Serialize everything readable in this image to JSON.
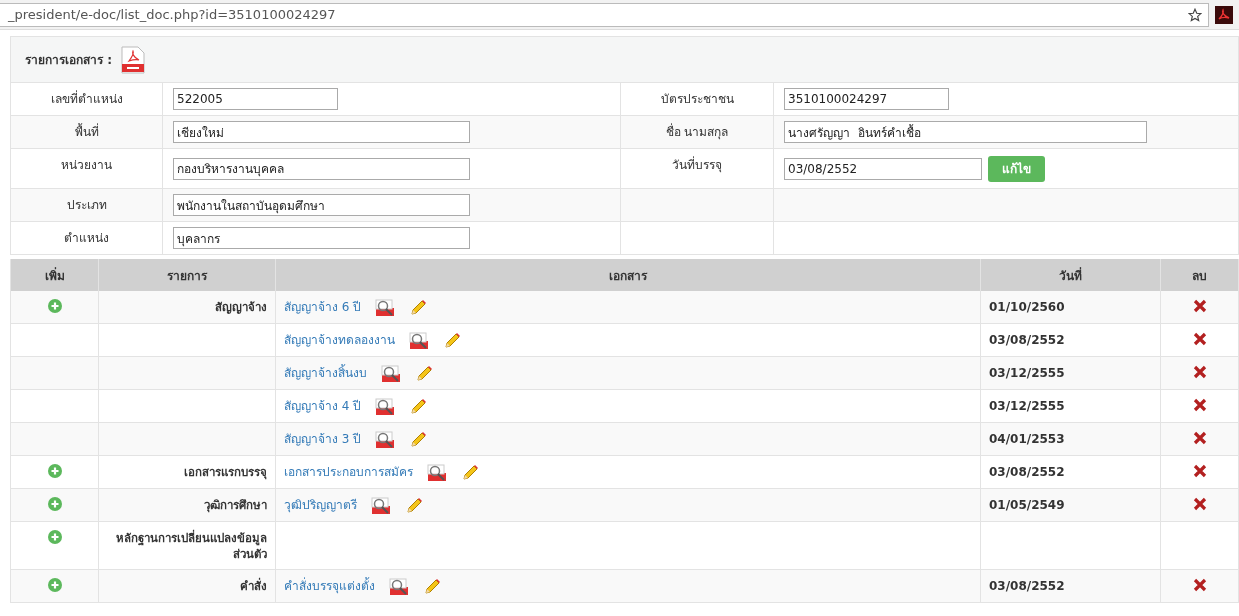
{
  "address_bar": {
    "url": "_president/e-doc/list_doc.php?id=3510100024297"
  },
  "panel": {
    "title": "รายการเอกสาร :"
  },
  "info_rows": [
    {
      "left": {
        "label": "เลขที่ตำแหน่ง",
        "value": "522005"
      },
      "right": {
        "label": "บัตรประชาชน",
        "value": "3510100024297"
      }
    },
    {
      "left": {
        "label": "พื้นที่",
        "value": "เชียงใหม่"
      },
      "right": {
        "label": "ชื่อ นามสกุล",
        "value": "นางศรัญญา  อินทร์คำเชื้อ"
      }
    },
    {
      "left": {
        "label": "หน่วยงาน",
        "value": "กองบริหารงานบุคคล"
      },
      "right": {
        "label": "วันที่บรรจุ",
        "value": "03/08/2552",
        "button": "แก้ไข"
      }
    },
    {
      "left": {
        "label": "ประเภท",
        "value": "พนักงานในสถาบันอุดมศึกษา"
      }
    },
    {
      "left": {
        "label": "ตำแหน่ง",
        "value": "บุคลากร"
      }
    }
  ],
  "table": {
    "columns": [
      "เพิ่ม",
      "รายการ",
      "เอกสาร",
      "วันที่",
      "ลบ"
    ],
    "rows": [
      {
        "add": true,
        "category": "สัญญาจ้าง",
        "document": "สัญญาจ้าง 6 ปี",
        "date": "01/10/2560"
      },
      {
        "add": false,
        "document": "สัญญาจ้างทดลองงาน",
        "date": "03/08/2552"
      },
      {
        "add": false,
        "document": "สัญญาจ้างสิ้นงบ",
        "date": "03/12/2555"
      },
      {
        "add": false,
        "document": "สัญญาจ้าง 4 ปี",
        "date": "03/12/2555"
      },
      {
        "add": false,
        "document": "สัญญาจ้าง 3 ปี",
        "date": "04/01/2553"
      },
      {
        "add": true,
        "category": "เอกสารแรกบรรจุ",
        "document": "เอกสารประกอบการสมัคร",
        "date": "03/08/2552"
      },
      {
        "add": true,
        "category": "วุฒิการศึกษา",
        "document": "วุฒิปริญญาตรี",
        "date": "01/05/2549"
      },
      {
        "add": true,
        "category": "หลักฐานการเปลี่ยนแปลงข้อมูลส่วนตัว"
      },
      {
        "add": true,
        "category": "คำสั่ง",
        "document": "คำสั่งบรรจุแต่งตั้ง",
        "date": "03/08/2552"
      }
    ]
  }
}
